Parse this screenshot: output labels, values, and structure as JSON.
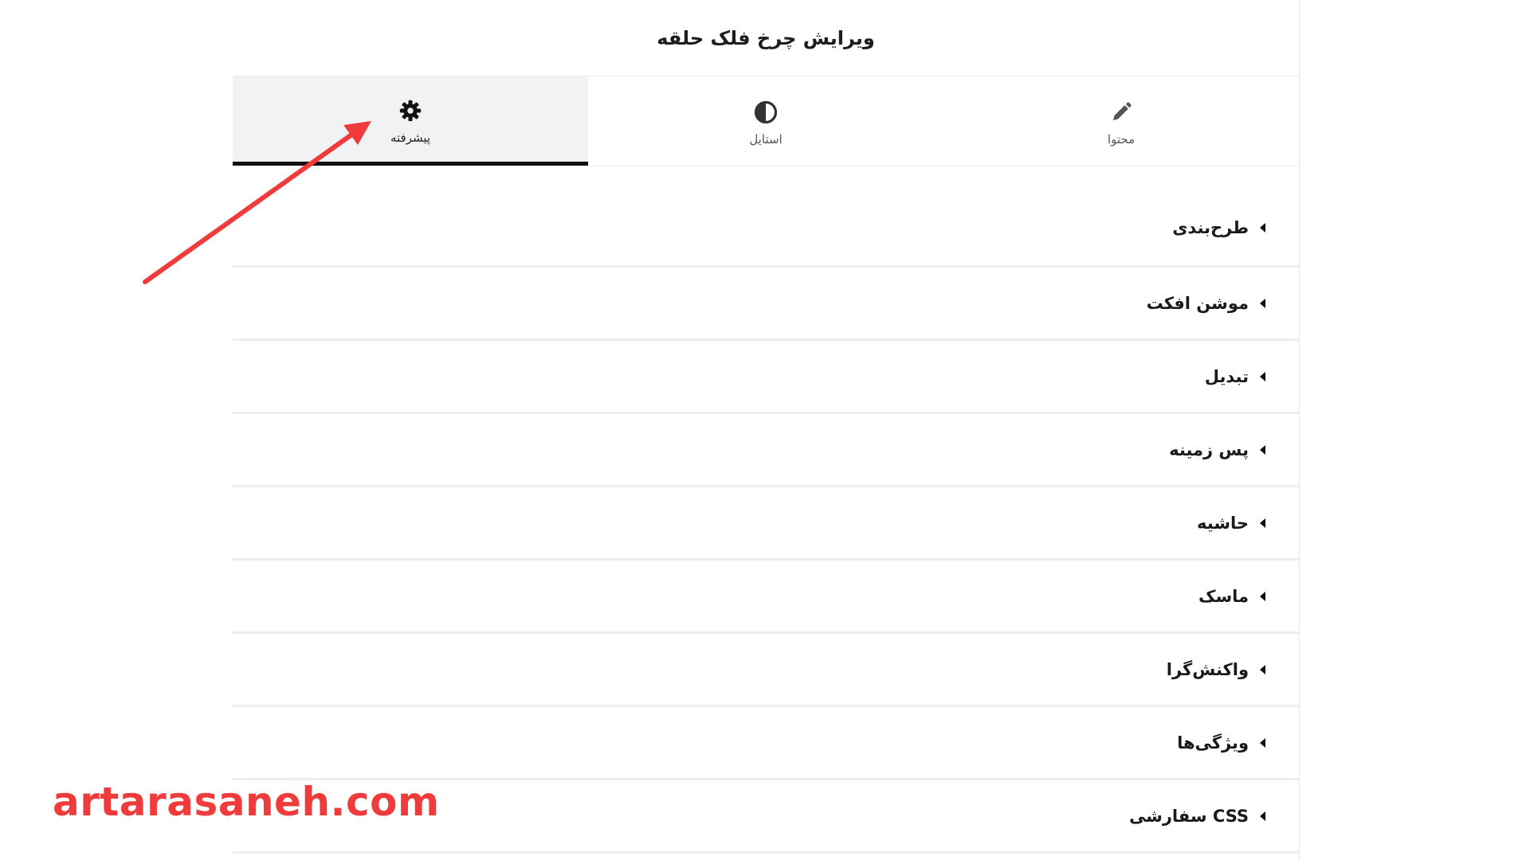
{
  "panel": {
    "title": "ویرایش چرخ فلک حلقه"
  },
  "tabs": [
    {
      "label": "محتوا",
      "icon": "pencil-icon",
      "active": false
    },
    {
      "label": "استایل",
      "icon": "half-circle-icon",
      "active": false
    },
    {
      "label": "پیشرفته",
      "icon": "gear-icon",
      "active": true
    }
  ],
  "sections": [
    {
      "label": "طرح‌بندی"
    },
    {
      "label": "موشن افکت"
    },
    {
      "label": "تبدیل"
    },
    {
      "label": "پس زمینه"
    },
    {
      "label": "حاشیه"
    },
    {
      "label": "ماسک"
    },
    {
      "label": "واکنش‌گرا"
    },
    {
      "label": "ویژگی‌ها"
    },
    {
      "label": "CSS سفارشی"
    }
  ],
  "watermark": {
    "text": "artarasaneh.com",
    "color": "#ef3b3b"
  },
  "colors": {
    "accent": "#111111",
    "annotation_arrow": "#ef3b3b",
    "active_tab_bg": "#f1f2f3",
    "divider": "#eceef1"
  }
}
